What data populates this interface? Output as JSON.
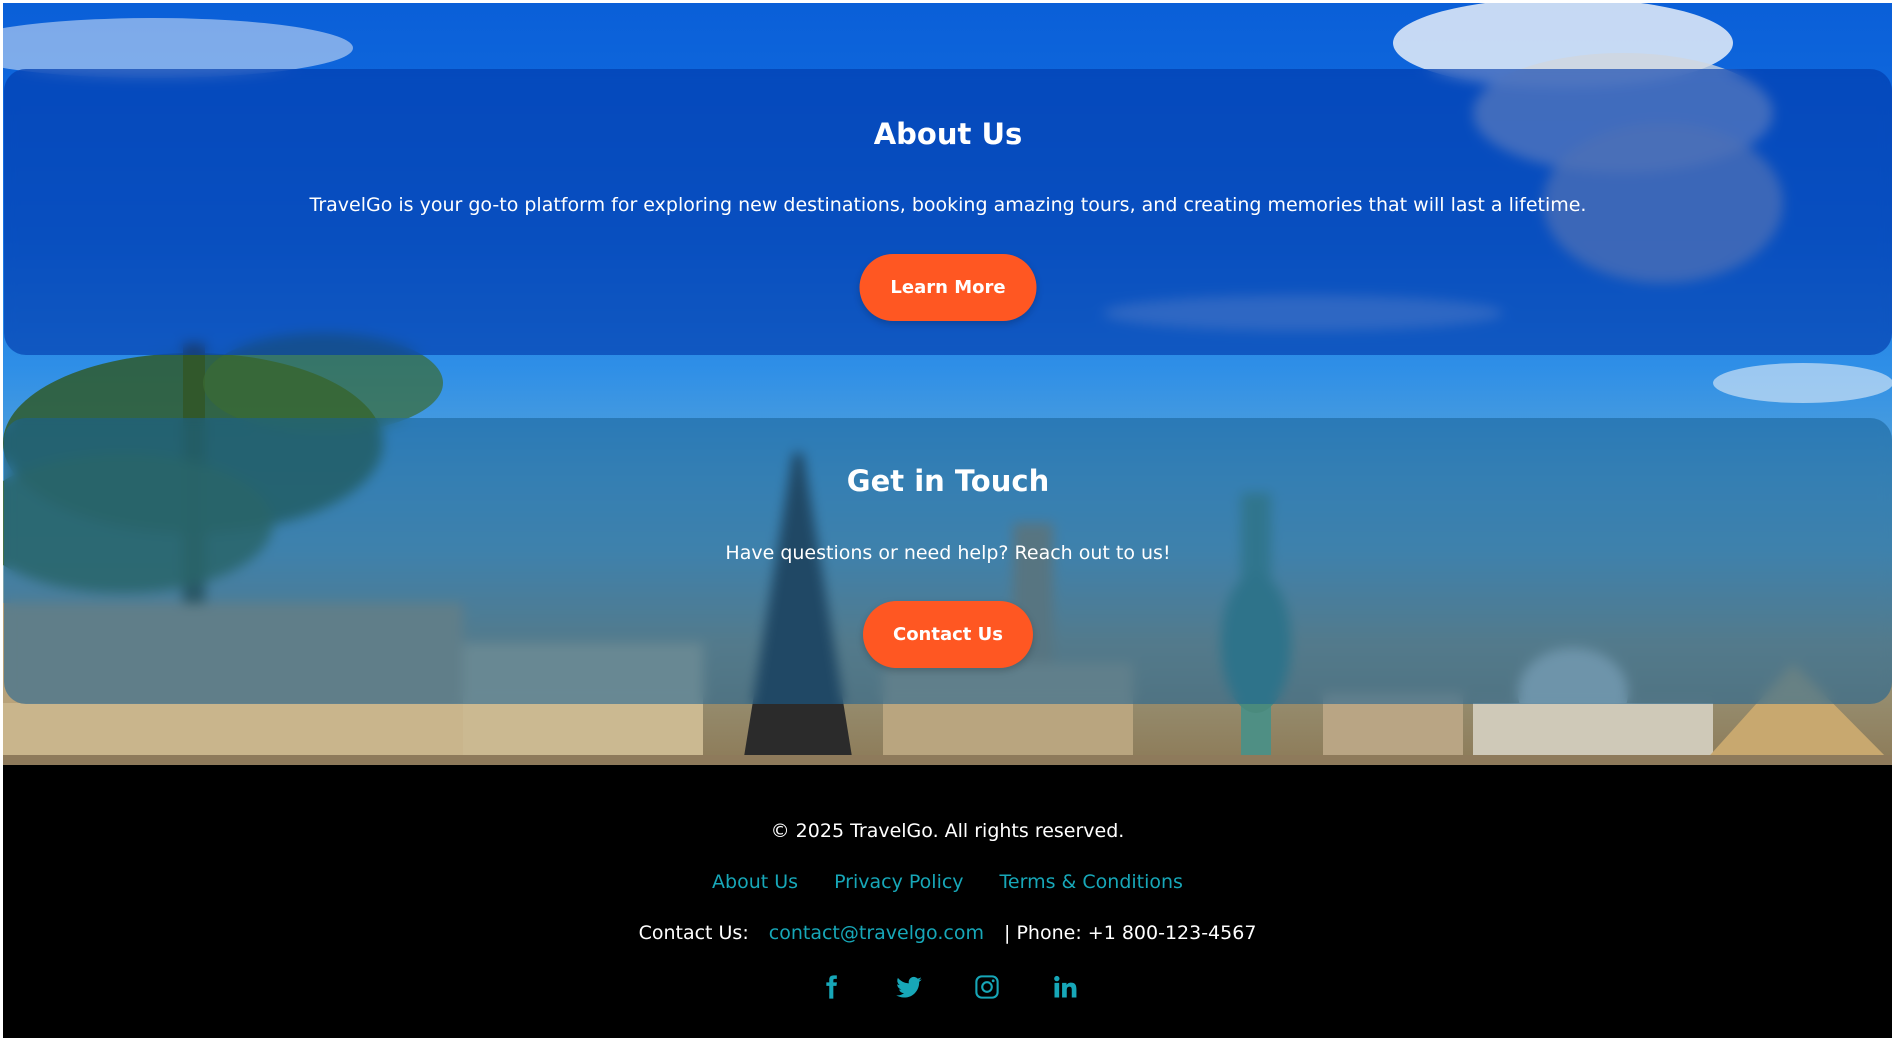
{
  "about": {
    "title": "About Us",
    "text": "TravelGo is your go-to platform for exploring new destinations, booking amazing tours, and creating memories that will last a lifetime.",
    "button_label": "Learn More"
  },
  "contact": {
    "title": "Get in Touch",
    "text": "Have questions or need help? Reach out to us!",
    "button_label": "Contact Us"
  },
  "footer": {
    "copyright": "© 2025 TravelGo. All rights reserved.",
    "links": [
      "About Us",
      "Privacy Policy",
      "Terms & Conditions"
    ],
    "contact_label": "Contact Us:",
    "email": "contact@travelgo.com",
    "phone": "| Phone: +1 800-123-4567",
    "social_icons": [
      "facebook-icon",
      "twitter-icon",
      "instagram-icon",
      "linkedin-icon"
    ]
  },
  "colors": {
    "accent_button": "#ff5722",
    "link": "#17a7b8",
    "footer_bg": "#000000"
  }
}
